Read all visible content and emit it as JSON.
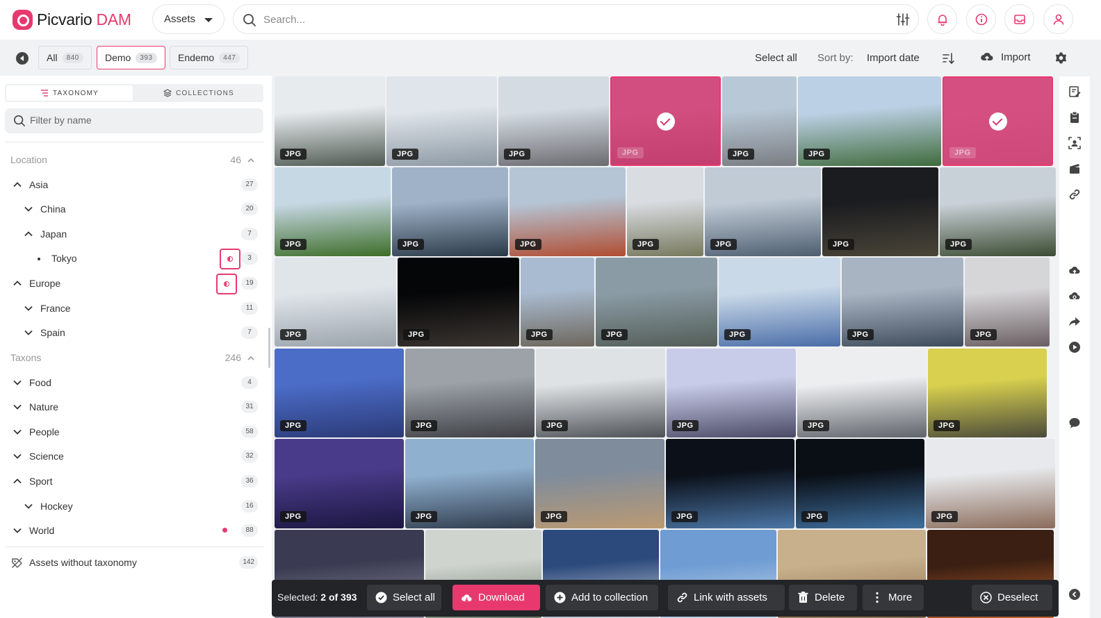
{
  "app": {
    "name_part1": "Picvario",
    "name_part2": "DAM",
    "accent_color": "#e8396f"
  },
  "header": {
    "scope_dropdown": "Assets",
    "search_placeholder": "Search...",
    "icons": [
      "sliders-icon",
      "bell-icon",
      "info-icon",
      "inbox-icon",
      "user-icon"
    ]
  },
  "toolbar": {
    "tabs": [
      {
        "label": "All",
        "count": "840"
      },
      {
        "label": "Demo",
        "count": "393"
      },
      {
        "label": "Endemo",
        "count": "447"
      }
    ],
    "select_all": "Select all",
    "sort_label": "Sort by:",
    "sort_value": "Import date",
    "import_label": "Import"
  },
  "sidebar": {
    "tabs": [
      "TAXONOMY",
      "COLLECTIONS"
    ],
    "filter_placeholder": "Filter by name",
    "sections": [
      {
        "label": "Location",
        "count": "46"
      },
      {
        "label": "Taxons",
        "count": "246"
      }
    ],
    "location_items": [
      {
        "label": "Asia",
        "count": "27"
      },
      {
        "label": "China",
        "count": "20"
      },
      {
        "label": "Japan",
        "count": "7"
      },
      {
        "label": "Tokyo",
        "count": "3"
      },
      {
        "label": "Europe",
        "count": "19"
      },
      {
        "label": "France",
        "count": "11"
      },
      {
        "label": "Spain",
        "count": "7"
      }
    ],
    "taxon_items": [
      {
        "label": "Food",
        "count": "4"
      },
      {
        "label": "Nature",
        "count": "31"
      },
      {
        "label": "People",
        "count": "58"
      },
      {
        "label": "Science",
        "count": "32"
      },
      {
        "label": "Sport",
        "count": "36"
      },
      {
        "label": "Hockey",
        "count": "16"
      },
      {
        "label": "World",
        "count": "88"
      }
    ],
    "no_taxonomy": {
      "label": "Assets without taxonomy",
      "count": "142"
    }
  },
  "grid": {
    "badge": "JPG",
    "tiles": [
      {
        "name": "museum-future-dubai",
        "c1": "#e7ebee",
        "c2": "#4f5a52",
        "selected": false
      },
      {
        "name": "twin-towers",
        "c1": "#dfe5ea",
        "c2": "#8c98a3",
        "selected": false
      },
      {
        "name": "tokyo-view-woman",
        "c1": "#d4dbe3",
        "c2": "#6b6b70",
        "selected": false
      },
      {
        "name": "city-selected",
        "c1": "#c9c4d2",
        "c2": "#6d6a72",
        "selected": true
      },
      {
        "name": "tokyo-tower",
        "c1": "#b8c8d6",
        "c2": "#7a7d82",
        "selected": false
      },
      {
        "name": "red-cabins",
        "c1": "#bcd0e5",
        "c2": "#3f6b3c",
        "selected": false
      },
      {
        "name": "flowers-selected",
        "c1": "#d7cdd9",
        "c2": "#b3a1a9",
        "selected": true
      },
      {
        "name": "greenhouse",
        "c1": "#c7d8e5",
        "c2": "#3d6e29",
        "selected": false
      },
      {
        "name": "stadium-dusk",
        "c1": "#9fb2c8",
        "c2": "#2a3947",
        "selected": false
      },
      {
        "name": "brick-building",
        "c1": "#b5c5d5",
        "c2": "#b04d32",
        "selected": false
      },
      {
        "name": "habitat-67",
        "c1": "#d9dde2",
        "c2": "#77795d",
        "selected": false
      },
      {
        "name": "skyline-water",
        "c1": "#c0cbd6",
        "c2": "#4e5e70",
        "selected": false
      },
      {
        "name": "night-towers",
        "c1": "#1b1c20",
        "c2": "#4a4538",
        "selected": false
      },
      {
        "name": "palm-trees-up",
        "c1": "#c9d1d8",
        "c2": "#3c4c33",
        "selected": false
      },
      {
        "name": "lab-worker",
        "c1": "#e0e5ea",
        "c2": "#9aa3ab",
        "selected": false
      },
      {
        "name": "rocket-night",
        "c1": "#050608",
        "c2": "#3b3530",
        "selected": false
      },
      {
        "name": "radio-dish",
        "c1": "#a9bbd0",
        "c2": "#6d675d",
        "selected": false
      },
      {
        "name": "aerial-factory",
        "c1": "#8a9ba5",
        "c2": "#545e58",
        "selected": false
      },
      {
        "name": "classroom",
        "c1": "#c9d9e8",
        "c2": "#4a6da8",
        "selected": false
      },
      {
        "name": "lab-machine",
        "c1": "#a8b4c2",
        "c2": "#3e4b5b",
        "selected": false
      },
      {
        "name": "art-portrait",
        "c1": "#d6d5d8",
        "c2": "#6a5f62",
        "selected": false
      },
      {
        "name": "speaker-podium",
        "c1": "#4b6cc7",
        "c2": "#2b3a77",
        "selected": false
      },
      {
        "name": "expo-engine",
        "c1": "#9ca2a8",
        "c2": "#3d3f44",
        "selected": false
      },
      {
        "name": "car-chassis",
        "c1": "#dfe2e5",
        "c2": "#4e5257",
        "selected": false
      },
      {
        "name": "car-platform",
        "c1": "#c9cce9",
        "c2": "#4a4a66",
        "selected": false
      },
      {
        "name": "plastic-sign",
        "c1": "#eceef0",
        "c2": "#5f646b",
        "selected": false
      },
      {
        "name": "yellow-truck",
        "c1": "#d8d04e",
        "c2": "#4b4b3a",
        "selected": false
      },
      {
        "name": "server-room",
        "c1": "#4a3b8a",
        "c2": "#1b1640",
        "selected": false
      },
      {
        "name": "robot-politician",
        "c1": "#8fb0cf",
        "c2": "#2f3b4c",
        "selected": false
      },
      {
        "name": "rocket-launch-day",
        "c1": "#7f8c9c",
        "c2": "#bb9a72",
        "selected": false
      },
      {
        "name": "space-station-1",
        "c1": "#0b1019",
        "c2": "#4b76a6",
        "selected": false
      },
      {
        "name": "space-station-2",
        "c1": "#0a0f16",
        "c2": "#3f6f9e",
        "selected": false
      },
      {
        "name": "microscope",
        "c1": "#e7e9ec",
        "c2": "#8a6b5a",
        "selected": false
      },
      {
        "name": "telescope-night",
        "c1": "#3a3b52",
        "c2": "#8c8a9a",
        "selected": false
      },
      {
        "name": "group-photo",
        "c1": "#cfd4cf",
        "c2": "#6d7c6a",
        "selected": false
      },
      {
        "name": "astronauts",
        "c1": "#2c4a7c",
        "c2": "#d6dae1",
        "selected": false
      },
      {
        "name": "launch-tower",
        "c1": "#6e9cd3",
        "c2": "#c6d7ea",
        "selected": false
      },
      {
        "name": "mars-rover",
        "c1": "#c8b08c",
        "c2": "#8a6b4a",
        "selected": false
      },
      {
        "name": "orange-machine",
        "c1": "#3a1f12",
        "c2": "#c4642e",
        "selected": false
      }
    ]
  },
  "bottom_bar": {
    "selected_prefix": "Selected:",
    "selected_value": "2 of 393",
    "select_all": "Select all",
    "download": "Download",
    "add_to_collection": "Add to collection",
    "link_with_assets": "Link with assets",
    "delete": "Delete",
    "more": "More",
    "deselect": "Deselect"
  }
}
